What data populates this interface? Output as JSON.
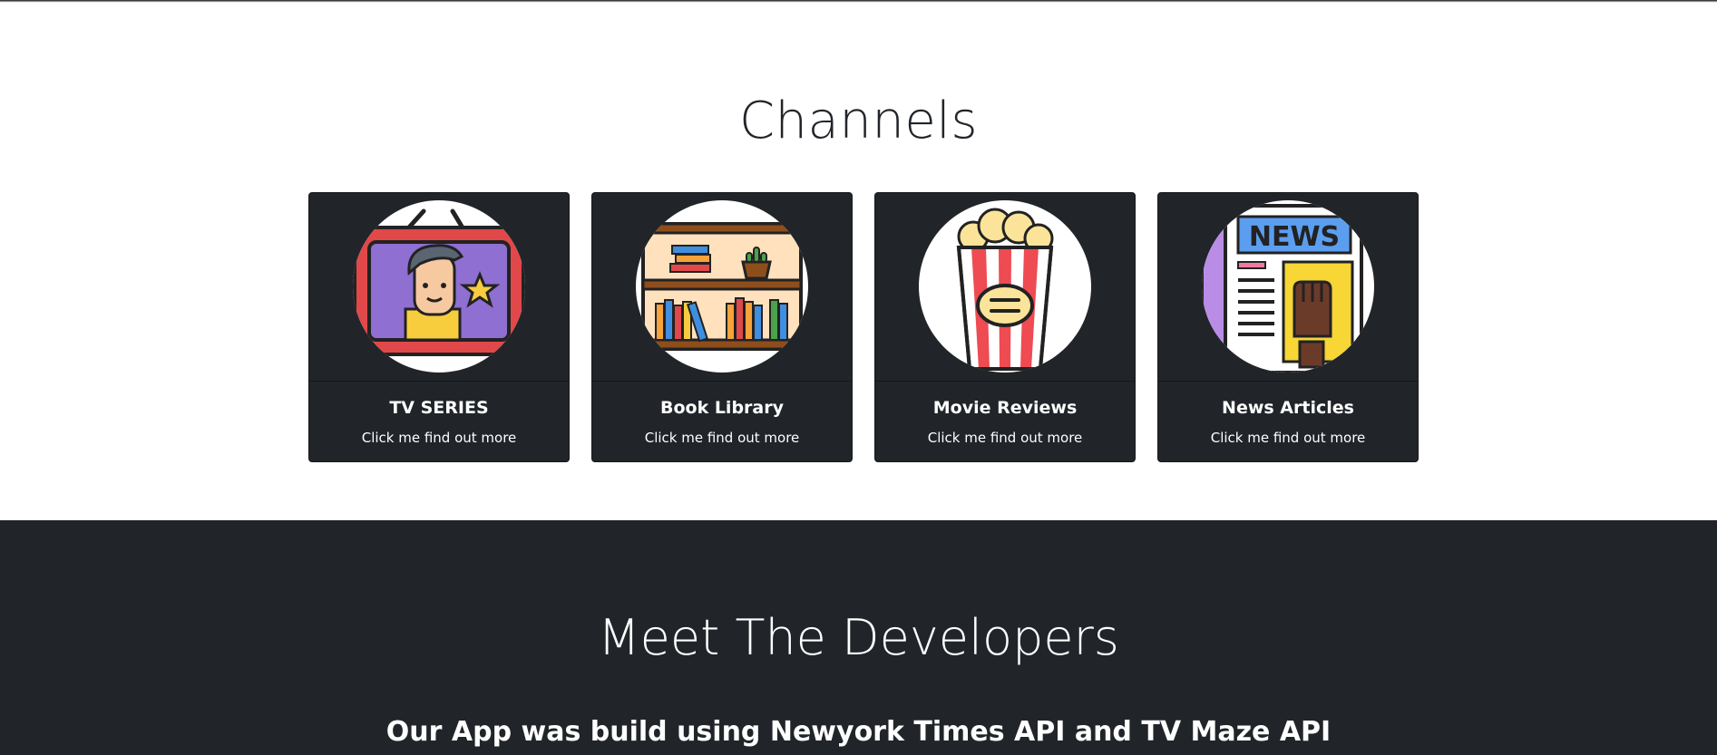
{
  "channels": {
    "title": "Channels",
    "cards": [
      {
        "icon": "tv-series-icon",
        "title": "TV SERIES",
        "text": "Click me find out more"
      },
      {
        "icon": "bookshelf-icon",
        "title": "Book Library",
        "text": "Click me find out more"
      },
      {
        "icon": "popcorn-icon",
        "title": "Movie Reviews",
        "text": "Click me find out more"
      },
      {
        "icon": "newspaper-icon",
        "title": "News Articles",
        "text": "Click me find out more",
        "icon_text": "NEWS"
      }
    ]
  },
  "developers": {
    "title": "Meet The Developers",
    "subtitle": "Our App was build using Newyork Times API and TV Maze API"
  },
  "colors": {
    "card_background": "#212529",
    "footer_background": "#212529",
    "heading": "#212529"
  }
}
